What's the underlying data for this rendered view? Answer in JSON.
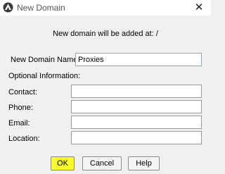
{
  "window": {
    "title": "New Domain",
    "app_icon": "app-logo-icon",
    "close_glyph": "✕"
  },
  "message": "New domain will be added at: /",
  "domain_name": {
    "label": "New Domain Name:",
    "value": "Proxies"
  },
  "optional_heading": "Optional Information:",
  "fields": {
    "contact": {
      "label": "Contact:",
      "value": ""
    },
    "phone": {
      "label": "Phone:",
      "value": ""
    },
    "email": {
      "label": "Email:",
      "value": ""
    },
    "location": {
      "label": "Location:",
      "value": ""
    }
  },
  "buttons": {
    "ok": "OK",
    "cancel": "Cancel",
    "help": "Help"
  },
  "colors": {
    "ok_highlight": "#fafa2a",
    "dialog_background": "#f0f0f0"
  }
}
